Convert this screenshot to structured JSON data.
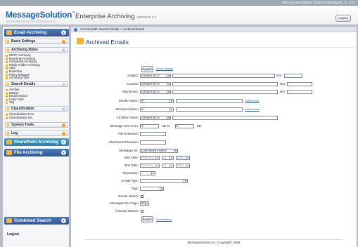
{
  "topbar": {
    "welcome": "Welcome,administrator Sessions Saturday,Feb 11, 2012"
  },
  "header": {
    "logo": "MessageSolution",
    "logo_tm": "™",
    "product": "Enterprise Archiving",
    "version": "VERSION 6.6",
    "logout": "Logout"
  },
  "sidebar": {
    "email_archiving": "Email Archiving",
    "basic_settings": "Basic Settings",
    "archiving_rules": "Archiving Rules",
    "archiving_rules_items": [
      "SMTP Archiving",
      "Real-time Archiving",
      "Scheduled Archiving",
      "Public Folder Archiving",
      "Stub",
      "Retention",
      "Policy Manager",
      "Archiving Filter"
    ],
    "search_emails": "Search Emails",
    "search_emails_items": [
      "Archive",
      "Basket",
      "Email Monitor",
      "Legal Hold",
      "Tag"
    ],
    "classification": "Classification",
    "classification_items": [
      "Classification Tree",
      "Classification Set"
    ],
    "system_tools": "System Tools",
    "log": "Log",
    "sharepoint": "SharePoint Archiving",
    "file_archiving": "File Archiving",
    "combined_search": "Combined Search",
    "logout": "Logout"
  },
  "breadcrumb": "Current path: Search Emails -> Archived Email",
  "page_title": "Archived Emails",
  "form": {
    "search_btn": "Search",
    "quick_search": "Quick Search",
    "subject": "Subject:",
    "content": "Content:",
    "attachment": "Attachment:",
    "sender_name": "Sender Name:",
    "recipient_name": "Recipient Name:",
    "all_other_fields": "All Other Fields:",
    "message_size_from": "Message Size From:",
    "kb_to": "KB To",
    "kb": "KB",
    "file_extension": "File Extension:",
    "attachment_filename": "Attachment Filename:",
    "messages_for": "Messages for:",
    "start_date": "Start Date:",
    "end_date": "End Date:",
    "repository": "Repository:",
    "email_type": "E-Mail Type:",
    "tags": "Tags:",
    "remote_search": "remote search:",
    "messages_per_page": "Messages Per Page:",
    "concept_search": "Concept Search:",
    "contains_all_of": "contains all of",
    "is": "is",
    "not": "Not:",
    "select_user": "Select User",
    "size_from": "0",
    "size_to": "0",
    "messages_for_value": "Last twelve months",
    "start_month": "February",
    "start_day": "11",
    "start_year": "2011",
    "end_month": "February",
    "end_day": "11",
    "end_year": "2012",
    "per_page": "50",
    "show_history": "ShowHistory"
  },
  "footer": "MessageSolution Inc. Copyright© 2009"
}
